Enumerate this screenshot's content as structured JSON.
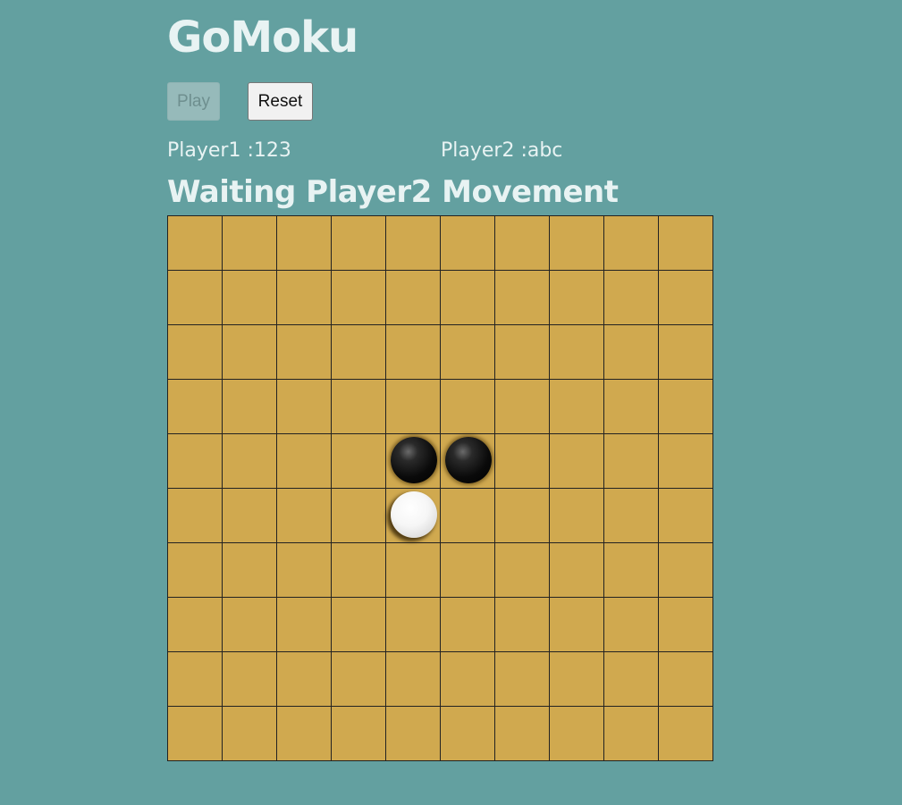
{
  "app": {
    "title": "GoMoku"
  },
  "controls": {
    "play_label": "Play",
    "play_disabled": true,
    "reset_label": "Reset"
  },
  "players": {
    "player1": "Player1 :123",
    "player2": "Player2 :abc"
  },
  "status": "Waiting Player2 Movement",
  "board": {
    "rows": 10,
    "cols": 10,
    "stones": [
      {
        "row": 4,
        "col": 4,
        "color": "black"
      },
      {
        "row": 4,
        "col": 5,
        "color": "black"
      },
      {
        "row": 5,
        "col": 4,
        "color": "white"
      }
    ]
  },
  "colors": {
    "background": "#63a0a0",
    "board": "#d0a94f",
    "grid_line": "#222222",
    "text": "#e8f3f3"
  }
}
